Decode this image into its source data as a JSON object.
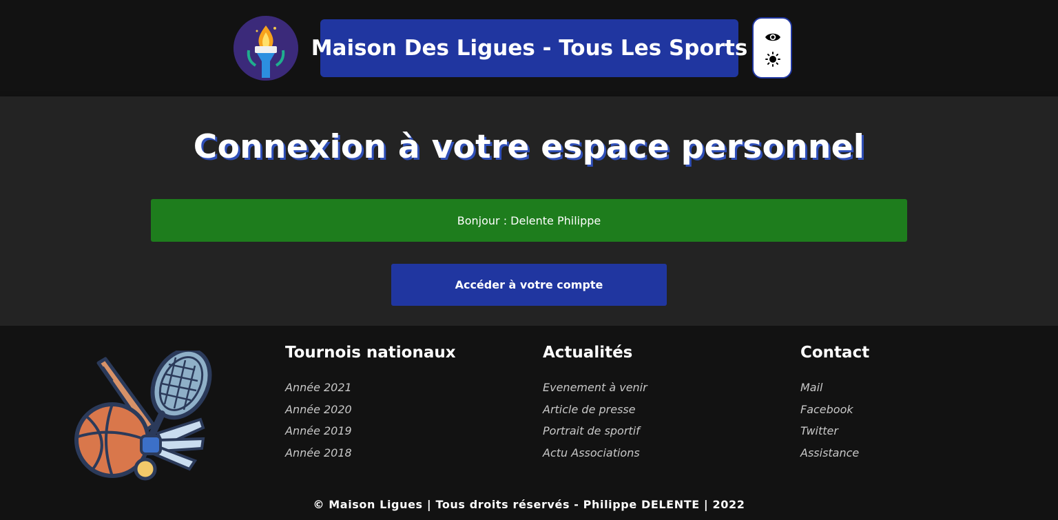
{
  "header": {
    "logo_icon": "olympic-torch-logo",
    "site_title": "Maison Des Ligues - Tous Les Sports",
    "toggle_icons": [
      "eye-icon",
      "sun-icon"
    ]
  },
  "main": {
    "title": "Connexion à votre espace personnel",
    "greeting": "Bonjour : Delente Philippe",
    "account_button": "Accéder à votre compte"
  },
  "footer": {
    "art_icon": "sports-equipment-illustration",
    "columns": [
      {
        "title": "Tournois nationaux",
        "links": [
          "Année 2021",
          "Année 2020",
          "Année 2019",
          "Année 2018"
        ]
      },
      {
        "title": "Actualités",
        "links": [
          "Evenement à venir",
          "Article de presse",
          "Portrait de sportif",
          "Actu Associations"
        ]
      },
      {
        "title": "Contact",
        "links": [
          "Mail",
          "Facebook",
          "Twitter",
          "Assistance"
        ]
      }
    ],
    "copyright": "© Maison Ligues | Tous droits réservés - Philippe DELENTE | 2022"
  },
  "colors": {
    "header_bg": "#121212",
    "main_bg": "#232323",
    "accent_blue": "#2036a0",
    "success_green": "#1e7d1d"
  }
}
